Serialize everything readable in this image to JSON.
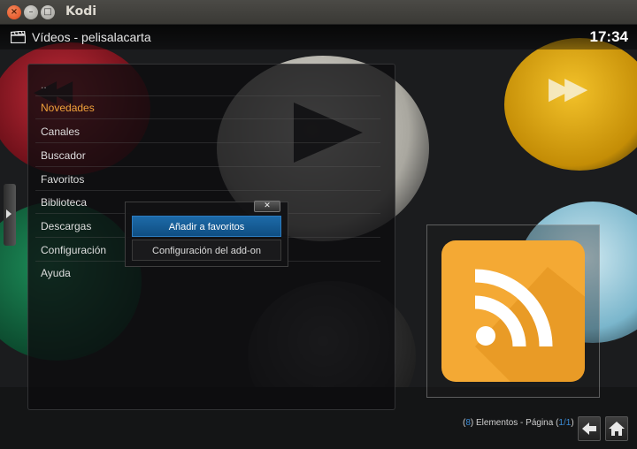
{
  "window": {
    "title": "Kodi",
    "close_glyph": "×",
    "min_glyph": "–",
    "max_glyph": "□"
  },
  "header": {
    "breadcrumb": "Vídeos - pelisalacarta",
    "clock": "17:34",
    "icon": "clapperboard-icon"
  },
  "list": {
    "items": [
      {
        "label": ".."
      },
      {
        "label": "Novedades"
      },
      {
        "label": "Canales"
      },
      {
        "label": "Buscador"
      },
      {
        "label": "Favoritos"
      },
      {
        "label": "Biblioteca"
      },
      {
        "label": "Descargas"
      },
      {
        "label": "Configuración"
      },
      {
        "label": "Ayuda"
      }
    ],
    "active_index": 1,
    "active_color": "#f0a13a"
  },
  "context_menu": {
    "close_glyph": "✕",
    "items": [
      {
        "label": "Añadir a favoritos"
      },
      {
        "label": "Configuración del add-on"
      }
    ],
    "selected_color": "#1d6aa8"
  },
  "thumbnail": {
    "icon": "rss-feed-icon",
    "color": "#f4a934"
  },
  "footer": {
    "open_paren": "(",
    "count": "8",
    "mid_text": ") Elementos - Página (",
    "page": "1/1",
    "close_paren": ")",
    "back_icon": "arrow-left-icon",
    "home_icon": "home-icon"
  }
}
